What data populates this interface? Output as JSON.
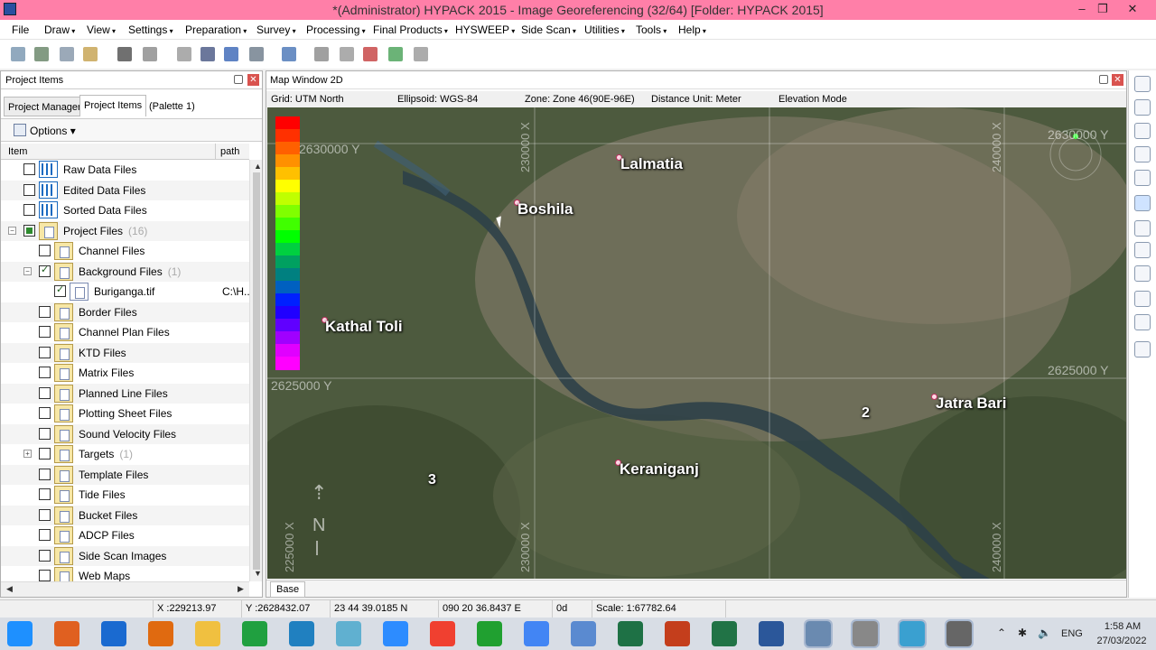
{
  "window": {
    "title": "*(Administrator) HYPACK 2015 - Image Georeferencing (32/64)  [Folder: HYPACK 2015]",
    "minimize_glyph": "–",
    "maximize_glyph": "❐",
    "close_glyph": "✕"
  },
  "menu": [
    "File",
    "Draw",
    "View",
    "Settings",
    "Preparation",
    "Survey",
    "Processing",
    "Final Products",
    "HYSWEEP",
    "Side Scan",
    "Utilities",
    "Tools",
    "Help"
  ],
  "toolbar_icons": [
    "save-icon",
    "globe-icon",
    "survey-icon",
    "edit-icon",
    "pencil-icon",
    "gear-icon",
    "curve-icon",
    "book-icon",
    "chart-icon",
    "zoom-icon",
    "rotate-icon",
    "list-icon",
    "sheet-icon",
    "triangle-icon",
    "image-icon",
    "database-icon"
  ],
  "left_panel": {
    "title": "Project Items",
    "tabs": [
      "Project Manager",
      "Project Items",
      "(Palette 1)"
    ],
    "options_label": "Options",
    "columns": {
      "item": "Item",
      "path": "path"
    },
    "rows": [
      {
        "label": "Raw Data Files",
        "count": "",
        "path": "",
        "level": 0,
        "checked": false,
        "icon": "grid",
        "expander": ""
      },
      {
        "label": "Edited Data Files",
        "count": "",
        "path": "",
        "level": 0,
        "checked": false,
        "icon": "grid",
        "expander": ""
      },
      {
        "label": "Sorted Data Files",
        "count": "",
        "path": "",
        "level": 0,
        "checked": false,
        "icon": "grid",
        "expander": ""
      },
      {
        "label": "Project Files",
        "count": "(16)",
        "path": "",
        "level": 0,
        "checked": "partial",
        "icon": "folder",
        "expander": "−"
      },
      {
        "label": "Channel Files",
        "count": "",
        "path": "",
        "level": 1,
        "checked": false,
        "icon": "folder",
        "expander": ""
      },
      {
        "label": "Background Files",
        "count": "(1)",
        "path": "",
        "level": 1,
        "checked": true,
        "icon": "folder",
        "expander": "−"
      },
      {
        "label": "Buriganga.tif",
        "count": "",
        "path": "C:\\H..",
        "level": 2,
        "checked": true,
        "icon": "file",
        "expander": ""
      },
      {
        "label": "Border Files",
        "count": "",
        "path": "",
        "level": 1,
        "checked": false,
        "icon": "folder",
        "expander": ""
      },
      {
        "label": "Channel Plan Files",
        "count": "",
        "path": "",
        "level": 1,
        "checked": false,
        "icon": "folder",
        "expander": ""
      },
      {
        "label": "KTD Files",
        "count": "",
        "path": "",
        "level": 1,
        "checked": false,
        "icon": "folder",
        "expander": ""
      },
      {
        "label": "Matrix Files",
        "count": "",
        "path": "",
        "level": 1,
        "checked": false,
        "icon": "folder",
        "expander": ""
      },
      {
        "label": "Planned Line Files",
        "count": "",
        "path": "",
        "level": 1,
        "checked": false,
        "icon": "folder",
        "expander": ""
      },
      {
        "label": "Plotting Sheet Files",
        "count": "",
        "path": "",
        "level": 1,
        "checked": false,
        "icon": "folder",
        "expander": ""
      },
      {
        "label": "Sound Velocity Files",
        "count": "",
        "path": "",
        "level": 1,
        "checked": false,
        "icon": "folder",
        "expander": ""
      },
      {
        "label": "Targets",
        "count": "(1)",
        "path": "",
        "level": 1,
        "checked": false,
        "icon": "folder",
        "expander": "+"
      },
      {
        "label": "Template Files",
        "count": "",
        "path": "",
        "level": 1,
        "checked": false,
        "icon": "folder",
        "expander": ""
      },
      {
        "label": "Tide Files",
        "count": "",
        "path": "",
        "level": 1,
        "checked": false,
        "icon": "folder",
        "expander": ""
      },
      {
        "label": "Bucket Files",
        "count": "",
        "path": "",
        "level": 1,
        "checked": false,
        "icon": "folder",
        "expander": ""
      },
      {
        "label": "ADCP Files",
        "count": "",
        "path": "",
        "level": 1,
        "checked": false,
        "icon": "folder",
        "expander": ""
      },
      {
        "label": "Side Scan Images",
        "count": "",
        "path": "",
        "level": 1,
        "checked": false,
        "icon": "folder",
        "expander": ""
      },
      {
        "label": "Web Maps",
        "count": "",
        "path": "",
        "level": 1,
        "checked": false,
        "icon": "folder",
        "expander": ""
      }
    ]
  },
  "map_window": {
    "title": "Map Window 2D",
    "info": {
      "grid": "Grid: UTM North",
      "ellipsoid": "Ellipsoid: WGS-84",
      "zone": "Zone: Zone 46(90E-96E)",
      "distance_unit": "Distance Unit: Meter",
      "elevation_mode": "Elevation Mode"
    },
    "places": [
      "Lalmatia",
      "Boshila",
      "Kathal Toli",
      "Jatra Bari",
      "Keraniganj"
    ],
    "grid_labels": {
      "y_top_left": "2630000 Y",
      "y_top_right": "2630000 Y",
      "y_mid_left": "2625000 Y",
      "y_mid_right": "2625000 Y",
      "x_left": "225000 X",
      "x_mid": "230000 X",
      "x_right": "240000 X",
      "x_top_mid": "230000 X",
      "x_top_right": "240000 X"
    },
    "markers": [
      "2",
      "3"
    ],
    "north_label": "N",
    "tab_label": "Base",
    "palette_colors": [
      "#ff0000",
      "#ff3000",
      "#ff6000",
      "#ff9000",
      "#ffc000",
      "#ffff00",
      "#c0ff00",
      "#80ff00",
      "#40ff00",
      "#00ff00",
      "#00d040",
      "#00a060",
      "#008080",
      "#0060c0",
      "#0020ff",
      "#2000ff",
      "#6000ff",
      "#a000ff",
      "#e000ff",
      "#ff00ff"
    ]
  },
  "status_bar": {
    "x": "X :229213.97",
    "y": "Y :2628432.07",
    "lat": "23 44 39.0185 N",
    "lon": "090 20 36.8437 E",
    "depth": "0d",
    "scale": "Scale: 1:67782.64"
  },
  "taskbar": {
    "apps": [
      "windows-start",
      "matlab",
      "ie",
      "firefox",
      "explorer",
      "excel-green",
      "magnifier",
      "database",
      "zoom",
      "git",
      "refresh",
      "chrome",
      "r-app",
      "excel",
      "powerpoint",
      "publisher",
      "word",
      "hypack-window",
      "hypack",
      "dvr",
      "hypack-logo"
    ],
    "app_colors": [
      "#1e90ff",
      "#e06020",
      "#1a6ad0",
      "#e06a10",
      "#f0c040",
      "#20a040",
      "#2080c0",
      "#60b0d0",
      "#2d8cff",
      "#f04030",
      "#20a030",
      "#4285f4",
      "#5a8ad0",
      "#1e7145",
      "#c43e1c",
      "#217346",
      "#2b579a",
      "#6a8ab0",
      "#888888",
      "#3aa0d0",
      "#666666"
    ],
    "lang": "ENG",
    "time": "1:58 AM",
    "date": "27/03/2022"
  }
}
